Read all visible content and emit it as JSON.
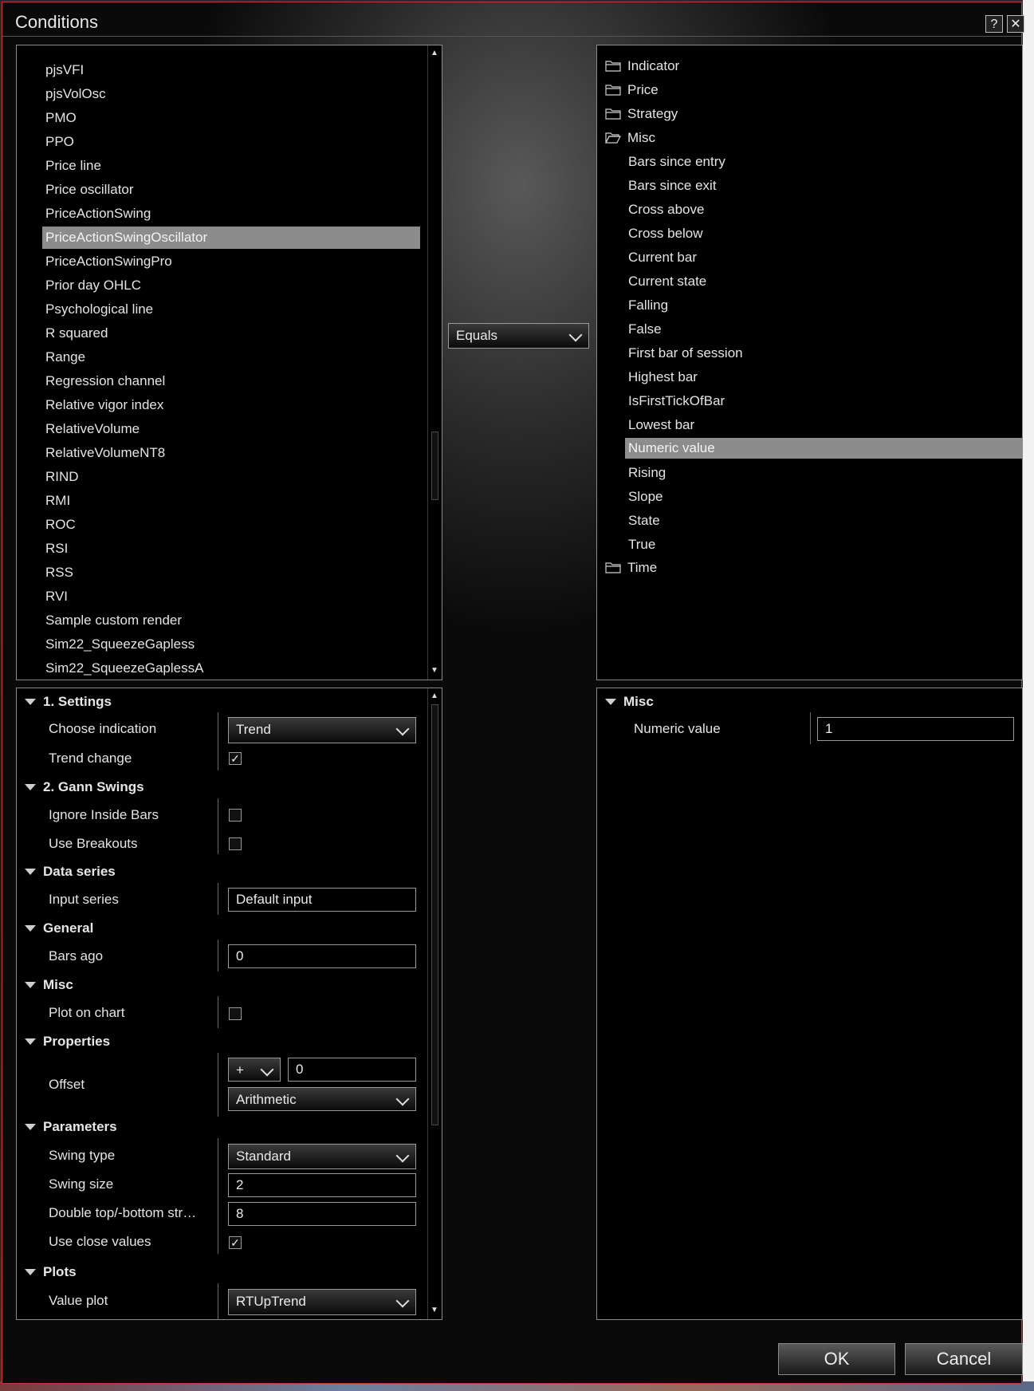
{
  "window": {
    "title": "Conditions",
    "help_label": "?",
    "close_label": "✕"
  },
  "indicators": {
    "items": [
      "pjsVFI",
      "pjsVolOsc",
      "PMO",
      "PPO",
      "Price line",
      "Price oscillator",
      "PriceActionSwing",
      "PriceActionSwingOscillator",
      "PriceActionSwingPro",
      "Prior day OHLC",
      "Psychological line",
      "R squared",
      "Range",
      "Regression channel",
      "Relative vigor index",
      "RelativeVolume",
      "RelativeVolumeNT8",
      "RIND",
      "RMI",
      "ROC",
      "RSI",
      "RSS",
      "RVI",
      "Sample custom render",
      "Sim22_SqueezeGapless",
      "Sim22_SqueezeGaplessA"
    ],
    "selected": "PriceActionSwingOscillator"
  },
  "operator": {
    "value": "Equals"
  },
  "tree": {
    "folders_top": [
      "Indicator",
      "Price",
      "Strategy",
      "Misc"
    ],
    "misc_children": [
      "Bars since entry",
      "Bars since exit",
      "Cross above",
      "Cross below",
      "Current bar",
      "Current state",
      "Falling",
      "False",
      "First bar of session",
      "Highest bar",
      "IsFirstTickOfBar",
      "Lowest bar",
      "Numeric value",
      "Rising",
      "Slope",
      "State",
      "True"
    ],
    "selected": "Numeric value",
    "folders_bottom": [
      "Time"
    ]
  },
  "props": {
    "settings": {
      "title": "1. Settings",
      "choose_indication_label": "Choose indication",
      "choose_indication_value": "Trend",
      "trend_change_label": "Trend change",
      "trend_change_mark": "✓"
    },
    "gann": {
      "title": "2. Gann Swings",
      "ignore_inside_label": "Ignore Inside Bars",
      "use_breakouts_label": "Use Breakouts"
    },
    "data_series": {
      "title": "Data series",
      "input_series_label": "Input series",
      "input_series_value": "Default input"
    },
    "general": {
      "title": "General",
      "bars_ago_label": "Bars ago",
      "bars_ago_value": "0"
    },
    "misc": {
      "title": "Misc",
      "plot_on_chart_label": "Plot on chart"
    },
    "properties": {
      "title": "Properties",
      "offset_label": "Offset",
      "offset_sign": "+",
      "offset_value": "0",
      "offset_type": "Arithmetic"
    },
    "parameters": {
      "title": "Parameters",
      "swing_type_label": "Swing type",
      "swing_type_value": "Standard",
      "swing_size_label": "Swing size",
      "swing_size_value": "2",
      "double_top_label": "Double top/-bottom str…",
      "double_top_value": "8",
      "use_close_label": "Use close values",
      "use_close_mark": "✓"
    },
    "plots": {
      "title": "Plots",
      "value_plot_label": "Value plot",
      "value_plot_value": "RTUpTrend"
    }
  },
  "right_props": {
    "title": "Misc",
    "numeric_value_label": "Numeric value",
    "numeric_value_value": "1"
  },
  "buttons": {
    "ok": "OK",
    "cancel": "Cancel"
  }
}
